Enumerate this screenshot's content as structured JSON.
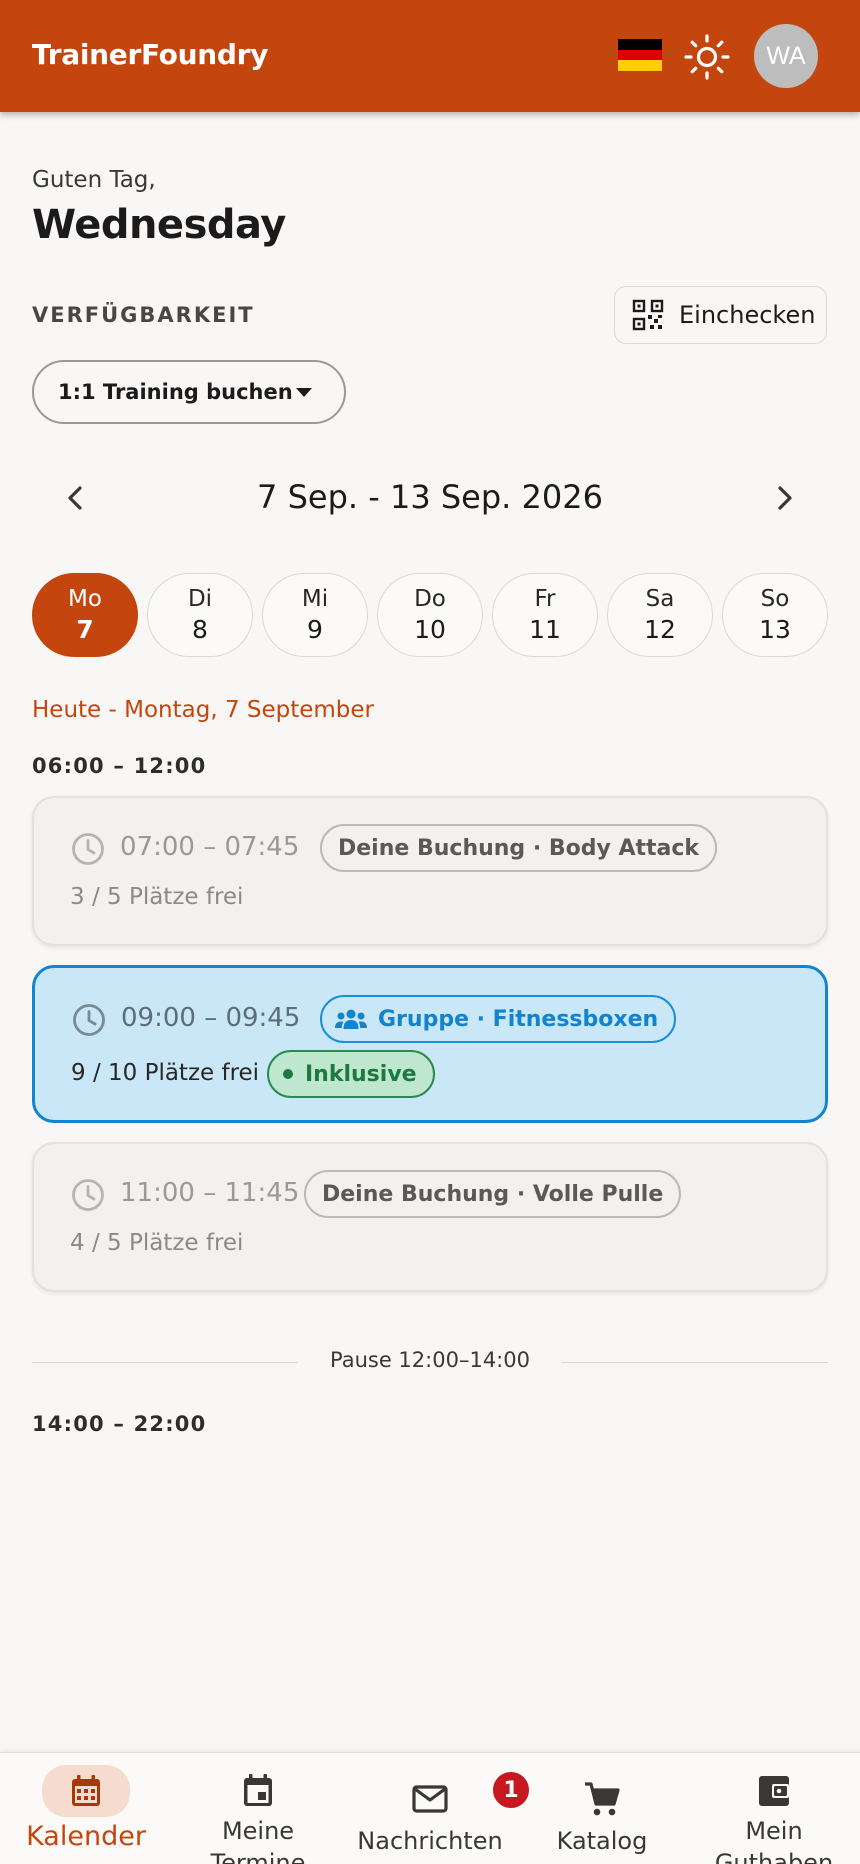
{
  "app": {
    "brand": "TrainerFoundry",
    "avatar_initials": "WA",
    "flag_colors": [
      "#000000",
      "#dd0000",
      "#ffce00"
    ],
    "accent_color": "#c4450d",
    "theme_icon": "sun-icon"
  },
  "header": {
    "greeting": "Guten Tag,",
    "day_name": "Wednesday"
  },
  "availability": {
    "label": "VERFÜGBARKEIT",
    "checkin_label": "Einchecken",
    "checkin_icon": "qr-code-icon",
    "booking_dropdown": "1:1 Training buchen"
  },
  "week": {
    "range": "7 Sep. - 13 Sep. 2026",
    "days": [
      {
        "name": "Mo",
        "date": "7",
        "selected": true
      },
      {
        "name": "Di",
        "date": "8",
        "selected": false
      },
      {
        "name": "Mi",
        "date": "9",
        "selected": false
      },
      {
        "name": "Do",
        "date": "10",
        "selected": false
      },
      {
        "name": "Fr",
        "date": "11",
        "selected": false
      },
      {
        "name": "Sa",
        "date": "12",
        "selected": false
      },
      {
        "name": "So",
        "date": "13",
        "selected": false
      }
    ]
  },
  "schedule": {
    "today_label": "Heute - Montag, 7 September",
    "block1": "06:00 – 12:00",
    "slots": [
      {
        "time": "07:00 – 07:45",
        "chip": "Deine Buchung · Body Attack",
        "seats": "3 / 5 Plätze frei",
        "state": "booked"
      },
      {
        "time": "09:00 – 09:45",
        "chip": "Gruppe · Fitnessboxen",
        "seats": "9 / 10 Plätze frei",
        "badge": "Inklusive",
        "state": "selected"
      },
      {
        "time": "11:00 – 11:45",
        "chip": "Deine Buchung · Volle Pulle",
        "seats": "4 / 5 Plätze frei",
        "state": "booked"
      }
    ],
    "pause": "Pause 12:00–14:00",
    "block2": "14:00 – 22:00"
  },
  "nav": {
    "items": [
      {
        "label": "Kalender",
        "icon": "calendar-icon",
        "active": true
      },
      {
        "label": "Meine\nTermine",
        "icon": "event-icon"
      },
      {
        "label": "Nachrichten",
        "icon": "mail-icon",
        "badge": "1"
      },
      {
        "label": "Katalog",
        "icon": "cart-icon"
      },
      {
        "label": "Mein\nGuthaben",
        "icon": "wallet-icon"
      }
    ]
  }
}
